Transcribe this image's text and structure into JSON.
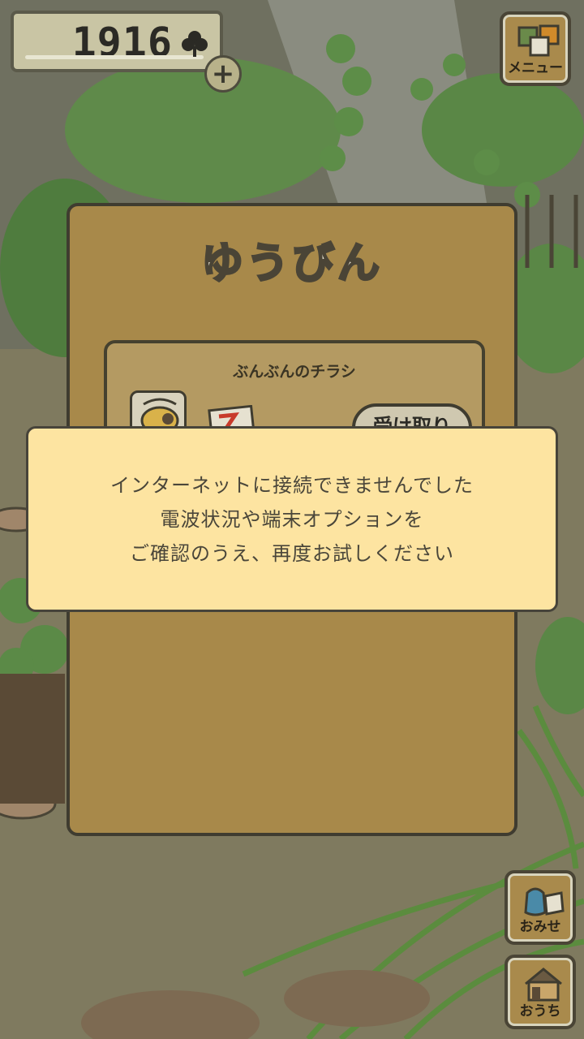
{
  "counter": {
    "clover_count": "1916"
  },
  "menu_button": {
    "label": "メニュー"
  },
  "mail_panel": {
    "title": "ゆうびん",
    "item": {
      "title": "ぶんぶんのチラシ",
      "receive_label": "受け取り"
    }
  },
  "error_dialog": {
    "lines": [
      "インターネットに接続できませんでした",
      "電波状況や端末オプションを",
      "ご確認のうえ、再度お試しください"
    ]
  },
  "shop_button": {
    "label": "おみせ"
  },
  "home_button": {
    "label": "おうち"
  },
  "colors": {
    "panel": "#a8894a",
    "dialog": "#fde4a1",
    "outline": "#3f3c30"
  }
}
